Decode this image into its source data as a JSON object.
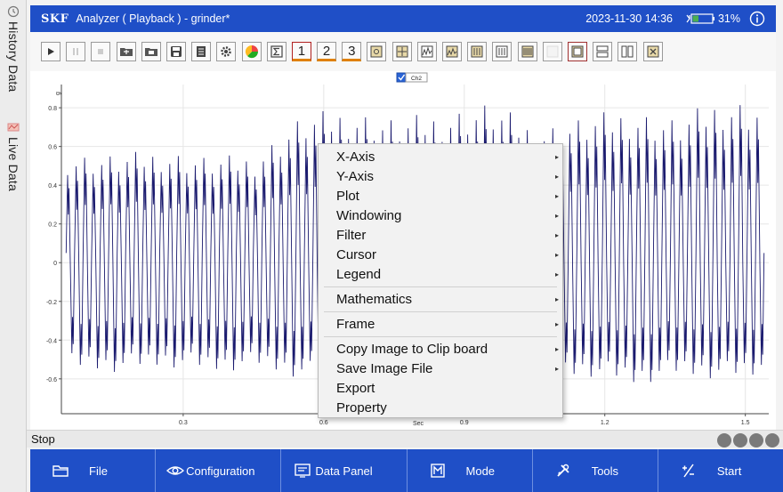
{
  "sidebar": {
    "history_label": "History Data",
    "live_label": "Live Data"
  },
  "titlebar": {
    "brand": "SKF",
    "title": "Analyzer ( Playback ) - grinder*",
    "datetime": "2023-11-30 14:36",
    "battery": "31%",
    "battery_level": 0.31,
    "info_icon": "info-icon"
  },
  "toolbar": {
    "buttons": [
      "play-icon",
      "pause-icon",
      "stop-icon",
      "folder-open-icon",
      "folder-icon",
      "save-icon",
      "document-icon",
      "gear-icon",
      "color-wheel-icon",
      "sigma-icon"
    ],
    "layout_numbers": [
      "1",
      "2",
      "3"
    ],
    "right_buttons": [
      "zoom-icon",
      "cursor-icon",
      "spectrum-icon",
      "spectrum2-icon",
      "bars-icon",
      "bars2-icon",
      "bars3-icon",
      "blank-icon",
      "layout-icon",
      "rows-icon",
      "columns-icon",
      "close-icon"
    ]
  },
  "chart_data": {
    "type": "line",
    "title": "",
    "xlabel": "Sec",
    "ylabel": "g",
    "legend": [
      "Ch2"
    ],
    "legend_checked": true,
    "y_ticks": [
      "0.8",
      "0.6",
      "0.4",
      "0.2",
      "0",
      "-0.2",
      "-0.4",
      "-0.6"
    ],
    "x_ticks": [
      "0.3",
      "0.6",
      "0.9",
      "1.2",
      "1.5"
    ],
    "xlim": [
      0.04,
      1.55
    ],
    "ylim": [
      -0.78,
      0.92
    ],
    "series": [
      {
        "color": "#1a1a6e",
        "description": "dense oscillating vibration waveform",
        "x": [
          0.05,
          0.15,
          0.25,
          0.35,
          0.45,
          0.55,
          0.65,
          0.75,
          0.85,
          0.95,
          1.05,
          1.15,
          1.25,
          1.35,
          1.45,
          1.55
        ],
        "y_peak": [
          0.58,
          0.57,
          0.6,
          0.56,
          0.57,
          0.78,
          0.82,
          0.76,
          0.8,
          0.85,
          0.72,
          0.77,
          0.82,
          0.76,
          0.88,
          0.84
        ],
        "y_trough": [
          -0.57,
          -0.58,
          -0.55,
          -0.58,
          -0.56,
          -0.62,
          -0.6,
          -0.61,
          -0.63,
          -0.6,
          -0.62,
          -0.6,
          -0.65,
          -0.6,
          -0.62,
          -0.6
        ]
      }
    ]
  },
  "context_menu": {
    "groups": [
      [
        "X-Axis",
        "Y-Axis",
        "Plot",
        "Windowing",
        "Filter",
        "Cursor",
        "Legend"
      ],
      [
        "Mathematics"
      ],
      [
        "Frame"
      ],
      [
        "Copy Image to Clip board",
        "Save Image File",
        "Export",
        "Property"
      ]
    ],
    "submenu_items": [
      "X-Axis",
      "Y-Axis",
      "Plot",
      "Windowing",
      "Filter",
      "Cursor",
      "Legend",
      "Mathematics",
      "Frame",
      "Copy Image to Clip board",
      "Save Image File"
    ]
  },
  "status": {
    "text": "Stop"
  },
  "bottom_nav": {
    "items": [
      {
        "label": "File",
        "icon": "folder-icon"
      },
      {
        "label": "Configuration",
        "icon": "eye-gear-icon"
      },
      {
        "label": "Data Panel",
        "icon": "data-panel-icon"
      },
      {
        "label": "Mode",
        "icon": "mode-icon"
      },
      {
        "label": "Tools",
        "icon": "tools-icon"
      },
      {
        "label": "Start",
        "icon": "start-icon"
      }
    ]
  }
}
